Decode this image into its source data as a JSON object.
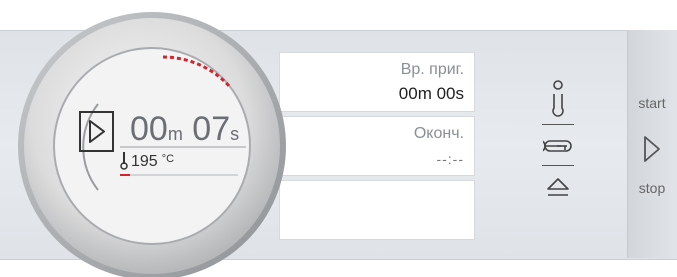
{
  "timer": {
    "minutes": "00",
    "min_unit": "m",
    "seconds": "07",
    "sec_unit": "s",
    "temperature": "195",
    "temp_unit": "°C"
  },
  "info": {
    "box1_label": "Вр. приг.",
    "box1_value": "00m 00s",
    "box2_label": "Оконч.",
    "box2_value": "--:--",
    "box3_label": ""
  },
  "controls": {
    "start_label": "start",
    "stop_label": "stop"
  },
  "icons": {
    "play": "play-icon",
    "thermometer": "thermometer-icon",
    "key": "key-lock-icon",
    "eject": "eject-icon"
  },
  "colors": {
    "progress_red": "#d4242b",
    "accent_dark": "#333333"
  }
}
